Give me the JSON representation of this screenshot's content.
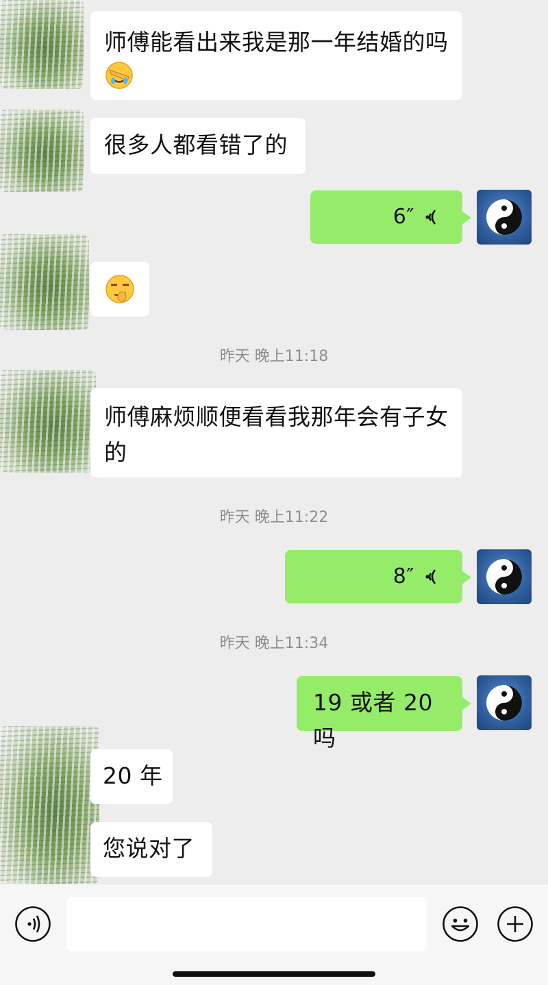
{
  "messages": [
    {
      "side": "in",
      "type": "text",
      "text": "师傅能看出来我是那一年结婚的吗",
      "emoji": "facepalm-emoji"
    },
    {
      "side": "in",
      "type": "text",
      "text": "很多人都看错了的"
    },
    {
      "side": "out",
      "type": "voice",
      "duration": "6″"
    },
    {
      "side": "in",
      "type": "emoji",
      "emoji": "smirk-emoji"
    },
    {
      "side": "in",
      "type": "text",
      "text": "师傅麻烦顺便看看我那年会有子女的"
    },
    {
      "side": "out",
      "type": "voice",
      "duration": "8″"
    },
    {
      "side": "out",
      "type": "text",
      "text": "19 或者 20 吗"
    },
    {
      "side": "in",
      "type": "text",
      "text": "20 年"
    },
    {
      "side": "in",
      "type": "text",
      "text": "您说对了"
    }
  ],
  "timestamps": [
    "昨天 晚上11:18",
    "昨天 晚上11:22",
    "昨天 晚上11:34"
  ],
  "input_bar": {
    "placeholder": "",
    "voice_icon": "voice-mode-icon",
    "emoji_icon": "emoji-face-icon",
    "plus_icon": "plus-icon"
  },
  "colors": {
    "background": "#ededed",
    "incoming_bubble": "#ffffff",
    "outgoing_bubble": "#95ec69",
    "timestamp_text": "#8d8d8d"
  }
}
